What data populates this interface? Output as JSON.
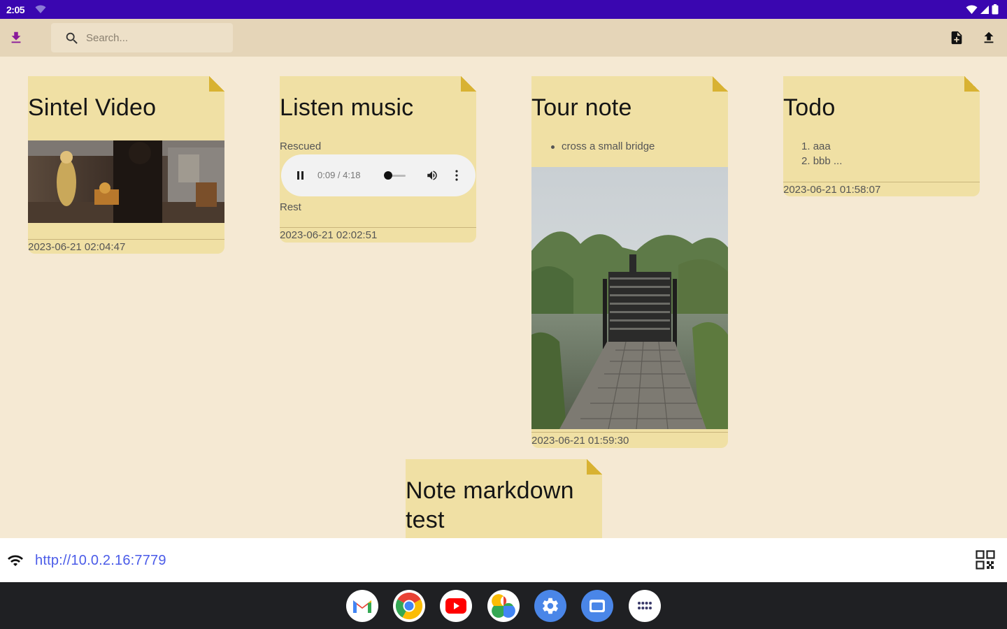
{
  "status_bar": {
    "time": "2:05",
    "bg_color": "#3a06b0"
  },
  "toolbar": {
    "search_placeholder": "Search...",
    "icons": [
      "download-icon",
      "search-icon",
      "new-note-icon",
      "upload-icon"
    ]
  },
  "notes": [
    {
      "title": "Sintel Video",
      "date": "2023-06-21 02:04:47",
      "media": "video-thumbnail"
    },
    {
      "title": "Listen music",
      "label_before": "Rescued",
      "audio_time": "0:09 / 4:18",
      "label_after": "Rest",
      "audio_progress": 0.035,
      "date": "2023-06-21 02:02:51"
    },
    {
      "title": "Tour note",
      "bullet": "cross a small bridge",
      "date": "2023-06-21 01:59:30",
      "media": "photo"
    },
    {
      "title": "Todo",
      "items": [
        "aaa",
        "bbb ..."
      ],
      "date": "2023-06-21 01:58:07"
    },
    {
      "title_line1": "Note markdown",
      "title_line2": "test"
    }
  ],
  "server": {
    "url": "http://10.0.2.16:7779"
  },
  "dock": {
    "apps": [
      "gmail-icon",
      "chrome-icon",
      "youtube-icon",
      "photos-icon",
      "settings-icon",
      "files-icon",
      "app-drawer-icon"
    ]
  },
  "colors": {
    "background": "#f5e9d3",
    "toolbar": "#e5d5b8",
    "note": "#f0e0a4",
    "note_fold": "#d8b232",
    "accent": "#8a1a9a",
    "link": "#4a5be8"
  }
}
